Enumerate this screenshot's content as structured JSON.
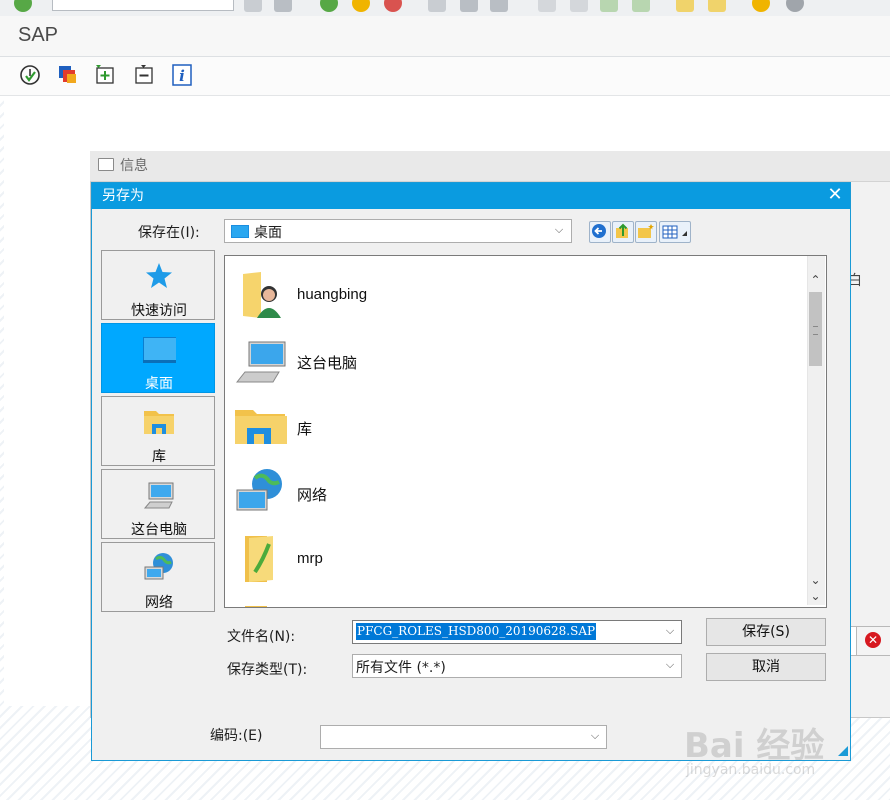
{
  "sap": {
    "title": "SAP",
    "toolbar_icons": [
      "enter-icon",
      "command-field",
      "back-icon",
      "save-icon",
      "ok-icon",
      "exit-icon",
      "cancel-icon",
      "print-icon",
      "find-icon",
      "find-next-icon",
      "first-page-icon",
      "prev-page-icon",
      "next-page-icon",
      "last-page-icon",
      "create-session-icon",
      "shortcut-icon",
      "help-icon",
      "settings-icon"
    ],
    "app_toolbar_icons": [
      "execute-icon",
      "copy-roles-icon",
      "add-icon",
      "remove-icon",
      "info-icon"
    ]
  },
  "info_popup": {
    "title": "信息",
    "side_text": "白"
  },
  "dialog": {
    "title": "另存为",
    "close_symbol": "✕",
    "save_in_label": "保存在(I):",
    "save_in_value": "桌面",
    "places": [
      {
        "label": "快速访问",
        "icon": "star-icon"
      },
      {
        "label": "桌面",
        "icon": "desktop-icon"
      },
      {
        "label": "库",
        "icon": "library-icon"
      },
      {
        "label": "这台电脑",
        "icon": "computer-icon"
      },
      {
        "label": "网络",
        "icon": "network-icon"
      }
    ],
    "files": [
      {
        "name": "huangbing",
        "icon": "user-folder-icon"
      },
      {
        "name": "这台电脑",
        "icon": "computer-icon"
      },
      {
        "name": "库",
        "icon": "library-folder-icon"
      },
      {
        "name": "网络",
        "icon": "network-icon"
      },
      {
        "name": "mrp",
        "icon": "folder-icon"
      }
    ],
    "filename_label": "文件名(N):",
    "filename_value": "PFCG_ROLES_HSD800_20190628.SAP",
    "filetype_label": "保存类型(T):",
    "filetype_value": "所有文件 (*.*)",
    "encoding_label": "编码:(E)",
    "encoding_value": "",
    "save_button": "保存(S)",
    "cancel_button": "取消"
  },
  "watermark": {
    "text": "Bai 经验",
    "sub": "jingyan.baidu.com"
  },
  "colors": {
    "dialog_title_bg": "#0a9be0",
    "place_active_bg": "#00a8ff",
    "selection": "#0078d7"
  }
}
